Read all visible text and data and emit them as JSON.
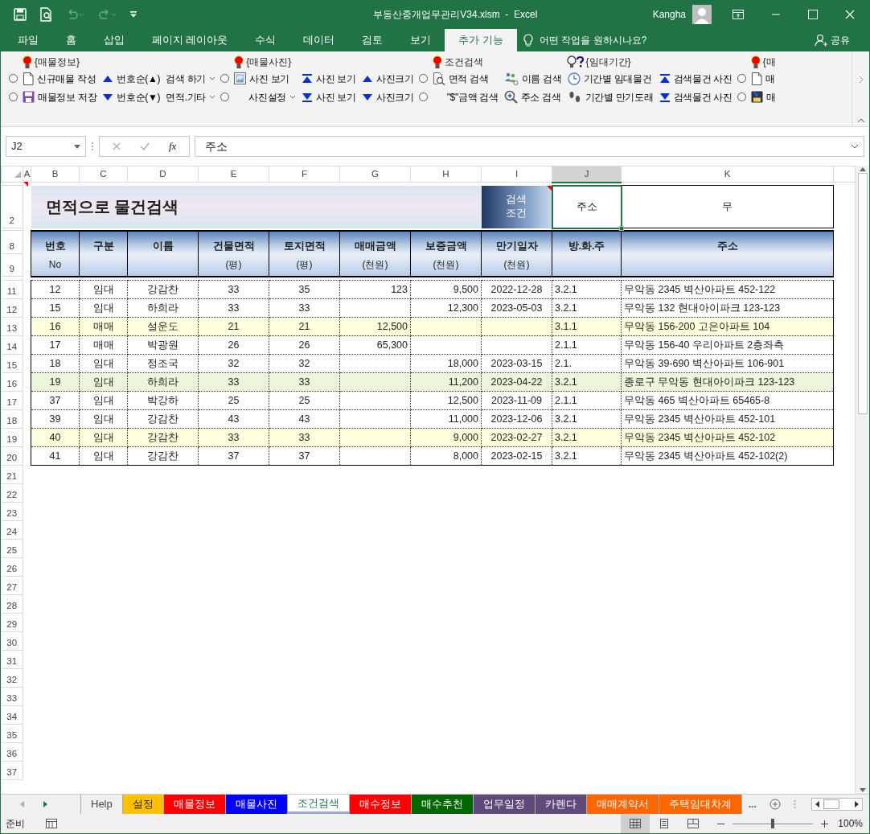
{
  "title_bar": {
    "title": "부동산중개업무관리V34.xlsm  -  Excel",
    "user": "Kangha"
  },
  "ribbon_tabs": [
    {
      "label": "파일",
      "selected": false
    },
    {
      "label": "홈",
      "selected": false
    },
    {
      "label": "삽입",
      "selected": false
    },
    {
      "label": "페이지 레이아웃",
      "selected": false
    },
    {
      "label": "수식",
      "selected": false
    },
    {
      "label": "데이터",
      "selected": false
    },
    {
      "label": "검토",
      "selected": false
    },
    {
      "label": "보기",
      "selected": false
    },
    {
      "label": "추가 기능",
      "selected": true
    }
  ],
  "tell_me": "어떤 작업을 원하시나요?",
  "share": "공유",
  "ribbon": {
    "columns": [
      {
        "kind": "radios",
        "items": [
          {
            "checked": false
          },
          {
            "checked": false
          }
        ]
      },
      {
        "kind": "buttons",
        "header": "{매물정보}",
        "items": [
          {
            "label": "신규매물 작성"
          },
          {
            "label": "매물정보 저장"
          }
        ]
      },
      {
        "kind": "buttons",
        "items": [
          {
            "label": "번호순(▲)"
          },
          {
            "label": "번호순(▼)"
          }
        ]
      },
      {
        "kind": "dropdowns",
        "items": [
          {
            "label": "검색 하기"
          },
          {
            "label": "면적.기타"
          }
        ]
      },
      {
        "kind": "radios",
        "items": [
          {
            "checked": false
          },
          {
            "checked": false
          }
        ]
      },
      {
        "kind": "buttons",
        "header": "{매물사진}",
        "items": [
          {
            "label": "사진 보기"
          },
          {
            "label": "사진설정"
          }
        ]
      },
      {
        "kind": "buttons",
        "items": [
          {
            "label": "사진 보기"
          },
          {
            "label": "사진 보기"
          }
        ]
      },
      {
        "kind": "buttons",
        "items": [
          {
            "label": "사진크기"
          },
          {
            "label": "사진크기"
          }
        ]
      },
      {
        "kind": "radios",
        "items": [
          {
            "checked": false
          },
          {
            "checked": false
          }
        ]
      },
      {
        "kind": "buttons",
        "header": "조건검색",
        "items": [
          {
            "label": "면적 검색"
          },
          {
            "label": "\"$\"금액 검색"
          }
        ]
      },
      {
        "kind": "buttons",
        "items": [
          {
            "label": "이름 검색"
          },
          {
            "label": "주소 검색"
          }
        ]
      },
      {
        "kind": "buttons",
        "header": "{임대기간}",
        "items": [
          {
            "label": "기간별 임대물건"
          },
          {
            "label": "기간별 만기도래"
          }
        ]
      },
      {
        "kind": "buttons",
        "items": [
          {
            "label": "검색물건 사진"
          },
          {
            "label": "검색물건 사진"
          }
        ]
      },
      {
        "kind": "radios",
        "items": [
          {
            "checked": false
          },
          {
            "checked": false
          }
        ]
      },
      {
        "kind": "buttons",
        "header": "{매",
        "items": [
          {
            "label": "매"
          },
          {
            "label": "매"
          }
        ]
      }
    ]
  },
  "formula_bar": {
    "name_box": "J2",
    "fx": "fx",
    "formula": "주소"
  },
  "column_headers": [
    {
      "label": "A",
      "selected": false
    },
    {
      "label": "B",
      "selected": false
    },
    {
      "label": "C",
      "selected": false
    },
    {
      "label": "D",
      "selected": false
    },
    {
      "label": "E",
      "selected": false
    },
    {
      "label": "F",
      "selected": false
    },
    {
      "label": "G",
      "selected": false
    },
    {
      "label": "H",
      "selected": false
    },
    {
      "label": "I",
      "selected": false
    },
    {
      "label": "J",
      "selected": true
    },
    {
      "label": "K",
      "selected": false
    }
  ],
  "sheet": {
    "title_row": "2",
    "title": "면적으로 물건검색",
    "condition_label": "검색 조건",
    "condition_field": "주소",
    "condition_value": "무",
    "header_rows": [
      "8",
      "9"
    ],
    "table_columns": [
      {
        "label": "번호",
        "sub": "No"
      },
      {
        "label": "구분"
      },
      {
        "label": "이름"
      },
      {
        "label": "건물면적",
        "sub": "(평)"
      },
      {
        "label": "토지면적",
        "sub": "(평)"
      },
      {
        "label": "매매금액",
        "sub": "(천원)"
      },
      {
        "label": "보증금액",
        "sub": "(천원)"
      },
      {
        "label": "만기일자",
        "sub": "(천원)"
      },
      {
        "label": "방.화.주"
      },
      {
        "label": "주소"
      }
    ],
    "rows": [
      {
        "row_number": "11",
        "cells": [
          "12",
          "임대",
          "강감찬",
          "33",
          "35",
          "123",
          "9,500",
          "2022-12-28",
          "3.2.1",
          "무악동 2345 벽산아파트 452-122"
        ]
      },
      {
        "row_number": "12",
        "cells": [
          "15",
          "임대",
          "하희라",
          "33",
          "33",
          "",
          "12,300",
          "2023-05-03",
          "3.2.1",
          "무악동 132 현대아이파크 123-123"
        ]
      },
      {
        "row_number": "13",
        "color": "#ffffdd",
        "cells": [
          "16",
          "매매",
          "설운도",
          "21",
          "21",
          "12,500",
          "",
          "",
          "3.1.1",
          "무악동 156-200 고은아파트 104"
        ]
      },
      {
        "row_number": "14",
        "cells": [
          "17",
          "매매",
          "박광원",
          "26",
          "26",
          "65,300",
          "",
          "",
          "2.1.1",
          "무악동 156-40 우리아파트 2층좌측"
        ]
      },
      {
        "row_number": "15",
        "cells": [
          "18",
          "임대",
          "정조국",
          "32",
          "32",
          "",
          "18,000",
          "2023-03-15",
          "2.1.",
          "무악동 39-690 벽산아파트 106-901"
        ]
      },
      {
        "row_number": "16",
        "color": "#ebf6dc",
        "cells": [
          "19",
          "임대",
          "하희라",
          "33",
          "33",
          "",
          "11,200",
          "2023-04-22",
          "3.2.1",
          "종로구 무악동 현대아이파크 123-123"
        ]
      },
      {
        "row_number": "17",
        "cells": [
          "37",
          "임대",
          "박강하",
          "25",
          "25",
          "",
          "12,500",
          "2023-11-09",
          "2.1.1",
          "무악동 465 벽산아파트 65465-8"
        ]
      },
      {
        "row_number": "18",
        "cells": [
          "39",
          "임대",
          "강감찬",
          "43",
          "43",
          "",
          "11,000",
          "2023-12-06",
          "3.2.1",
          "무악동 2345 벽산아파트 452-101"
        ]
      },
      {
        "row_number": "19",
        "color": "#ffffdd",
        "cells": [
          "40",
          "임대",
          "강감찬",
          "33",
          "33",
          "",
          "9,000",
          "2023-02-27",
          "3.2.1",
          "무악동 2345 벽산아파트 452-102"
        ]
      },
      {
        "row_number": "20",
        "cells": [
          "41",
          "임대",
          "강감찬",
          "37",
          "37",
          "",
          "8,000",
          "2023-02-15",
          "3.2.1",
          "무악동 2345 벽산아파트 452-102(2)"
        ]
      }
    ],
    "empty_rows": [
      "21",
      "22",
      "23",
      "24",
      "25",
      "26",
      "27",
      "28",
      "29",
      "30",
      "31",
      "32",
      "33",
      "34",
      "35",
      "36",
      "37"
    ]
  },
  "sheet_tabs": [
    {
      "label": "Help",
      "selected": false
    },
    {
      "label": "설정",
      "color": "#ffc000",
      "selected": false
    },
    {
      "label": "매물정보",
      "color": "#ff0000",
      "selected": false
    },
    {
      "label": "매물사진",
      "color": "#0000ff",
      "selected": false
    },
    {
      "label": "조건검색",
      "selected": true
    },
    {
      "label": "매수정보",
      "color": "#ff0000",
      "selected": false
    },
    {
      "label": "매수추천",
      "color": "#006600",
      "selected": false
    },
    {
      "label": "업무일정",
      "color": "#604a7b",
      "selected": false
    },
    {
      "label": "카렌다",
      "color": "#604a7b",
      "selected": false
    },
    {
      "label": "매매계약서",
      "color": "#ff6600",
      "selected": false
    },
    {
      "label": "주택임대차계",
      "color": "#ff6600",
      "selected": false
    }
  ],
  "more_tabs": "...",
  "status_bar": {
    "status": "준비",
    "views": [
      {
        "selected": true
      },
      {
        "selected": false
      },
      {
        "selected": false
      }
    ],
    "zoom_slider": {
      "level": 0.5
    },
    "zoom": "100%"
  }
}
